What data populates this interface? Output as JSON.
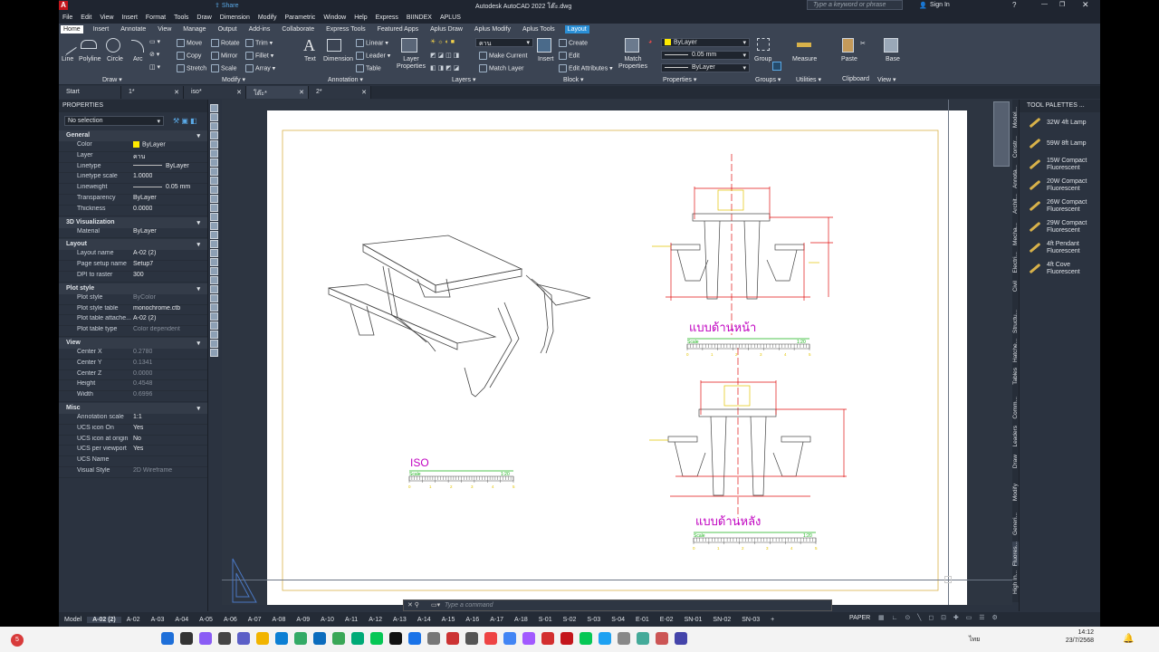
{
  "window": {
    "title": "Autodesk AutoCAD 2022   โต๊ะ.dwg",
    "share_label": "Share",
    "search_placeholder": "Type a keyword or phrase",
    "signin": "Sign In"
  },
  "menu": [
    "File",
    "Edit",
    "View",
    "Insert",
    "Format",
    "Tools",
    "Draw",
    "Dimension",
    "Modify",
    "Parametric",
    "Window",
    "Help",
    "Express",
    "BIINDEX",
    "APLUS"
  ],
  "ribbon_tabs": [
    "Home",
    "Insert",
    "Annotate",
    "View",
    "Manage",
    "Output",
    "Add-ins",
    "Collaborate",
    "Express Tools",
    "Featured Apps",
    "Aplus Draw",
    "Aplus Modify",
    "Aplus Tools",
    "Layout"
  ],
  "ribbon": {
    "draw": {
      "line": "Line",
      "polyline": "Polyline",
      "circle": "Circle",
      "arc": "Arc",
      "title": "Draw ▾"
    },
    "modify": {
      "move": "Move",
      "rotate": "Rotate",
      "trim": "Trim ▾",
      "copy": "Copy",
      "mirror": "Mirror",
      "fillet": "Fillet ▾",
      "stretch": "Stretch",
      "scale": "Scale",
      "array": "Array ▾",
      "title": "Modify ▾"
    },
    "annotation": {
      "text": "Text",
      "dimension": "Dimension",
      "linear": "Linear ▾",
      "leader": "Leader ▾",
      "table": "Table",
      "title": "Annotation ▾"
    },
    "layers": {
      "props": "Layer Properties",
      "current": "คาน",
      "make_current": "Make Current",
      "match_layer": "Match Layer",
      "title": "Layers ▾"
    },
    "block": {
      "insert": "Insert",
      "create": "Create",
      "edit": "Edit",
      "edit_attr": "Edit Attributes ▾",
      "title": "Block ▾"
    },
    "properties": {
      "match": "Match Properties",
      "color": "ByLayer",
      "lineweight": "0.05 mm",
      "linetype": "ByLayer",
      "title": "Properties ▾"
    },
    "groups": {
      "group": "Group",
      "title": "Groups ▾"
    },
    "utilities": {
      "measure": "Measure",
      "title": "Utilities ▾"
    },
    "clipboard": {
      "paste": "Paste",
      "title": "Clipboard"
    },
    "view": {
      "base": "Base",
      "title": "View ▾"
    }
  },
  "doc_tabs": [
    {
      "label": "Start"
    },
    {
      "label": "1*"
    },
    {
      "label": "iso*"
    },
    {
      "label": "โต๊ะ*"
    },
    {
      "label": "2*"
    }
  ],
  "properties": {
    "header": "PROPERTIES",
    "selection": "No selection",
    "sections": [
      {
        "title": "General",
        "rows": [
          [
            "Color",
            "ByLayer"
          ],
          [
            "Layer",
            "คาน"
          ],
          [
            "Linetype",
            "ByLayer"
          ],
          [
            "Linetype scale",
            "1.0000"
          ],
          [
            "Lineweight",
            "0.05 mm"
          ],
          [
            "Transparency",
            "ByLayer"
          ],
          [
            "Thickness",
            "0.0000"
          ]
        ]
      },
      {
        "title": "3D Visualization",
        "rows": [
          [
            "Material",
            "ByLayer"
          ]
        ]
      },
      {
        "title": "Layout",
        "rows": [
          [
            "Layout name",
            "A-02 (2)"
          ],
          [
            "Page setup name",
            "Setup7"
          ],
          [
            "DPI to raster",
            "300"
          ]
        ]
      },
      {
        "title": "Plot style",
        "rows": [
          [
            "Plot style",
            "ByColor"
          ],
          [
            "Plot style table",
            "monochrome.ctb"
          ],
          [
            "Plot table attache...",
            "A-02 (2)"
          ],
          [
            "Plot table type",
            "Color dependent"
          ]
        ]
      },
      {
        "title": "View",
        "rows": [
          [
            "Center X",
            "0.2780"
          ],
          [
            "Center Y",
            "0.1341"
          ],
          [
            "Center Z",
            "0.0000"
          ],
          [
            "Height",
            "0.4548"
          ],
          [
            "Width",
            "0.6996"
          ]
        ]
      },
      {
        "title": "Misc",
        "rows": [
          [
            "Annotation scale",
            "1:1"
          ],
          [
            "UCS icon On",
            "Yes"
          ],
          [
            "UCS icon at origin",
            "No"
          ],
          [
            "UCS per viewport",
            "Yes"
          ],
          [
            "UCS Name",
            ""
          ],
          [
            "Visual Style",
            "2D Wireframe"
          ]
        ]
      }
    ]
  },
  "drawing": {
    "iso_label": "ISO",
    "front_label": "แบบด้านหน้า",
    "back_label": "แบบด้านหลัง",
    "scale_label": "Scale",
    "scale_ratio": "1:20",
    "ticks": [
      "0",
      "1",
      "2",
      "3",
      "4",
      "5"
    ]
  },
  "tool_palette": {
    "header": "TOOL PALETTES ...",
    "items": [
      "32W 4ft Lamp",
      "59W 8ft Lamp",
      "15W Compact Fluorescent",
      "20W Compact Fluorescent",
      "26W Compact Fluorescent",
      "29W Compact Fluorescent",
      "4ft Pendant Fluorescent",
      "4ft Cove Fluorescent"
    ],
    "side_tabs": [
      "Model...",
      "Constr...",
      "Annota...",
      "Archit...",
      "Mecha...",
      "Electri...",
      "Civil",
      "Structu...",
      "Hatche...",
      "Tables",
      "Comm...",
      "Leaders",
      "Draw",
      "Modify",
      "Generi...",
      "Fluores...",
      "High In..."
    ]
  },
  "command": {
    "placeholder": "Type a command"
  },
  "layout_tabs": [
    "Model",
    "A-02 (2)",
    "A-02",
    "A-03",
    "A-04",
    "A-05",
    "A-06",
    "A-07",
    "A-08",
    "A-09",
    "A-10",
    "A-11",
    "A-12",
    "A-13",
    "A-14",
    "A-15",
    "A-16",
    "A-17",
    "A-18",
    "S-01",
    "S-02",
    "S-03",
    "S-04",
    "E-01",
    "E-02",
    "SN-01",
    "SN-02",
    "SN-03",
    "+"
  ],
  "status": {
    "paper": "PAPER"
  },
  "taskbar": {
    "lang": "ไทย",
    "time": "14:12",
    "date": "23/7/2568",
    "badge": "5"
  },
  "colors": {
    "magenta": "#c000c0",
    "green": "#19b319",
    "red": "#e01010",
    "yellow": "#e3c400",
    "accent": "#2a8fd6"
  }
}
